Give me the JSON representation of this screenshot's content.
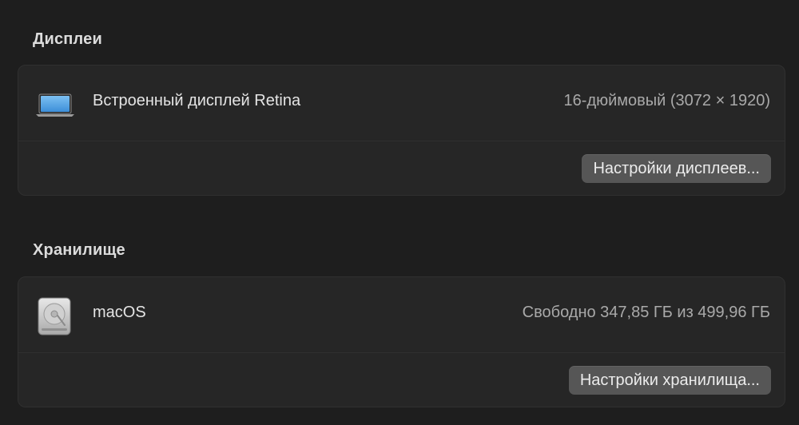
{
  "displays": {
    "title": "Дисплеи",
    "item": {
      "name": "Встроенный дисплей Retina",
      "value": "16-дюймовый (3072 × 1920)",
      "icon": "laptop-icon"
    },
    "button_label": "Настройки дисплеев..."
  },
  "storage": {
    "title": "Хранилище",
    "item": {
      "name": "macOS",
      "value": "Свободно 347,85 ГБ из 499,96 ГБ",
      "icon": "hard-drive-icon"
    },
    "button_label": "Настройки хранилища..."
  },
  "colors": {
    "background": "#1e1e1e",
    "card": "#262626",
    "button": "#565656",
    "laptop_screen": "#5aa9e8"
  }
}
